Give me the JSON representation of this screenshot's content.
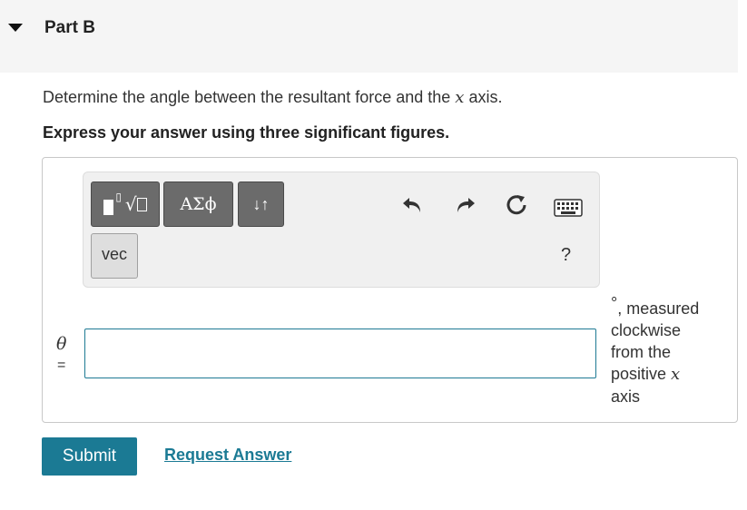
{
  "header": {
    "part_title": "Part B"
  },
  "question": {
    "prompt_before": "Determine the angle between the resultant force and the ",
    "prompt_var": "x",
    "prompt_after": " axis.",
    "instruction": "Express your answer using three significant figures."
  },
  "toolbar": {
    "greek_label": "ΑΣϕ",
    "arrows_label": "↓↑",
    "vec_label": "vec",
    "help_label": "?",
    "icons": [
      "templates-icon",
      "undo-icon",
      "redo-icon",
      "reset-icon",
      "keyboard-icon"
    ]
  },
  "answer": {
    "variable": "θ",
    "equals": "=",
    "value": "",
    "units_degree": "°",
    "units_line1": ", measured",
    "units_line2": "clockwise",
    "units_line3": "from the",
    "units_line4_before": "positive ",
    "units_line4_var": "x",
    "units_line5": "axis"
  },
  "actions": {
    "submit_label": "Submit",
    "request_label": "Request Answer"
  },
  "colors": {
    "accent": "#1b7a94",
    "toolbar_button": "#6b6b6b",
    "header_bg": "#f5f5f5"
  }
}
